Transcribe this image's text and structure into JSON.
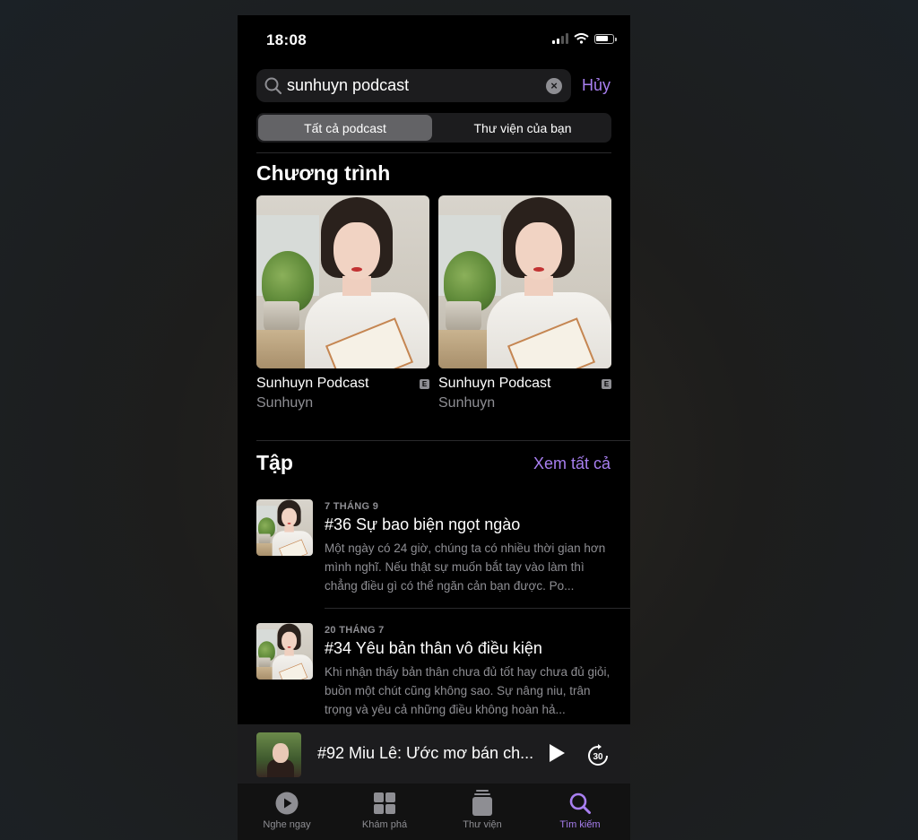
{
  "status_bar": {
    "time": "18:08"
  },
  "search": {
    "query": "sunhuyn podcast",
    "cancel_label": "Hủy"
  },
  "segments": [
    {
      "label": "Tất cả podcast",
      "selected": true
    },
    {
      "label": "Thư viện của bạn",
      "selected": false
    }
  ],
  "shows_section": {
    "title": "Chương trình",
    "items": [
      {
        "title": "Sunhuyn Podcast",
        "author": "Sunhuyn",
        "explicit_badge": "E"
      },
      {
        "title": "Sunhuyn Podcast",
        "author": "Sunhuyn",
        "explicit_badge": "E"
      }
    ]
  },
  "episodes_section": {
    "title": "Tập",
    "see_all_label": "Xem tất cả",
    "items": [
      {
        "date": "7 THÁNG 9",
        "title": "#36 Sự bao biện ngọt ngào",
        "description": "Một ngày có 24 giờ, chúng ta có nhiều thời gian hơn mình nghĩ. Nếu thật sự muốn bắt tay vào làm thì chẳng điều gì có thể ngăn cản bạn được. Po..."
      },
      {
        "date": "20 THÁNG 7",
        "title": "#34 Yêu bản thân vô điều kiện",
        "description": "Khi nhận thấy bản thân chưa đủ tốt hay chưa đủ giỏi, buồn một chút cũng không sao. Sự nâng niu, trân trọng và yêu cả những điều không hoàn hả..."
      }
    ]
  },
  "mini_player": {
    "title": "#92 Miu Lê: Ước mơ bán ch...",
    "skip_seconds": "30"
  },
  "tab_bar": [
    {
      "label": "Nghe ngay",
      "icon": "play-circle-icon",
      "active": false
    },
    {
      "label": "Khám phá",
      "icon": "grid-icon",
      "active": false
    },
    {
      "label": "Thư viện",
      "icon": "library-stack-icon",
      "active": false
    },
    {
      "label": "Tìm kiếm",
      "icon": "search-icon",
      "active": true
    }
  ],
  "colors": {
    "accent": "#a87ff0",
    "background": "#000000",
    "secondary_text": "#8e8e93"
  }
}
